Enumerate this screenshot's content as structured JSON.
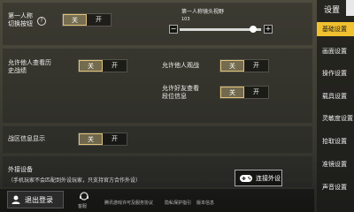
{
  "settings": {
    "first_person_switch": {
      "label_line1": "第一人称",
      "label_line2": "切换按钮",
      "help": "?",
      "off": "关",
      "on": "开"
    },
    "camera_fov": {
      "title": "第一人称镜头视野",
      "value": "103",
      "minus": "−",
      "plus": "+",
      "level": 0.9
    },
    "show_history": {
      "label_line1": "允许他人查看历",
      "label_line2": "史战绩",
      "off": "关",
      "on": "开"
    },
    "allow_spectate": {
      "label": "允许他人观战",
      "off": "关",
      "on": "开"
    },
    "show_rank": {
      "label_line1": "允许好友查看",
      "label_line2": "段位信息",
      "off": "关",
      "on": "开"
    },
    "region_info": {
      "label": "战区信息显示",
      "off": "关",
      "on": "开"
    },
    "peripheral": {
      "label": "外接设备",
      "note": "（手机玩家不会匹配到外设玩家，只支持官方合作外设）",
      "connect": "连接外设"
    }
  },
  "bottom": {
    "logout": "退出登录",
    "service": "客服",
    "link1": "腾讯游戏许可及服务协议",
    "link2": "隐私保护指引",
    "link3": "版本信息"
  },
  "sidebar": {
    "title": "设置",
    "items": [
      "基础设置",
      "画面设置",
      "操作设置",
      "载具设置",
      "灵敏度设置",
      "拾取设置",
      "准镜设置",
      "声音设置"
    ]
  },
  "colors": {
    "active_tab": "#f0c030",
    "selected_outline": "#e2c47a"
  }
}
